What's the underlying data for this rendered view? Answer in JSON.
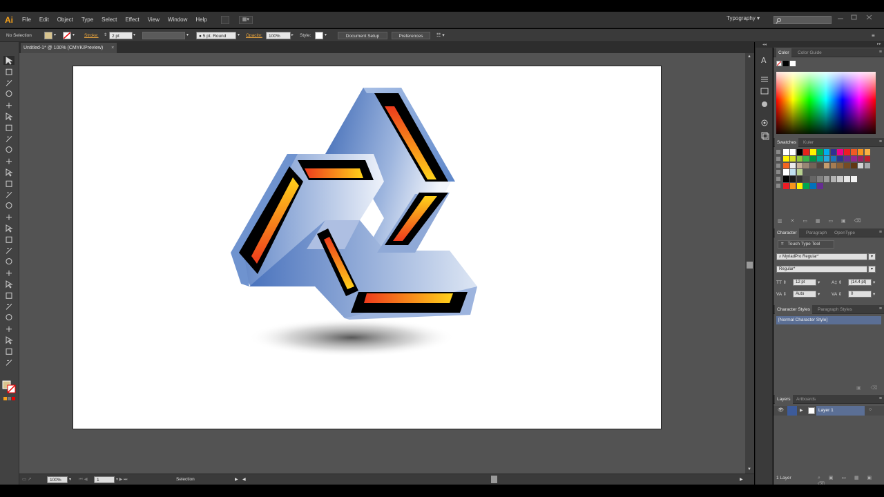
{
  "app": {
    "logo": "Ai"
  },
  "menu": [
    "File",
    "Edit",
    "Object",
    "Type",
    "Select",
    "Effect",
    "View",
    "Window",
    "Help"
  ],
  "workspace": {
    "name": "Typography",
    "arrow": "▾"
  },
  "control": {
    "selection": "No Selection",
    "stroke_label": "Stroke:",
    "stroke_value": "2 pt",
    "brush": "5 pt. Round",
    "opacity_label": "Opacity:",
    "opacity_value": "100%",
    "style_label": "Style:",
    "doc_setup": "Document Setup",
    "preferences": "Preferences",
    "fill_color": "#d8c48f"
  },
  "document": {
    "tab": "Untitled-1* @ 100% (CMYK/Preview)",
    "close": "×"
  },
  "status": {
    "zoom": "100%",
    "page": "1",
    "tool": "Selection"
  },
  "panels": {
    "color": {
      "tabs": [
        "Color",
        "Color Guide"
      ]
    },
    "swatches": {
      "tabs": [
        "Swatches",
        "Kuler"
      ]
    },
    "character": {
      "tabs": [
        "Character",
        "Paragraph",
        "OpenType"
      ],
      "touch_tool": "Touch Type Tool",
      "font_family": "MyriadPro Regular*",
      "font_style": "Regular*",
      "size": "12 pt",
      "leading": "(14.4 pt)",
      "kerning": "Auto",
      "tracking": "0"
    },
    "styles": {
      "tabs": [
        "Character Styles",
        "Paragraph Styles"
      ],
      "item": "[Normal Character Style]"
    },
    "layers": {
      "tabs": [
        "Layers",
        "Artboards"
      ],
      "layer": "Layer 1",
      "count": "1 Layer"
    }
  },
  "colors": {
    "logo_orange": "#f7a21b",
    "selection_blue": "#5b6f95",
    "artwork_blue": "#4f79bf",
    "artwork_light": "#e7edf8",
    "stripe_red": "#ee3b1c",
    "stripe_yellow": "#ffd21a"
  }
}
